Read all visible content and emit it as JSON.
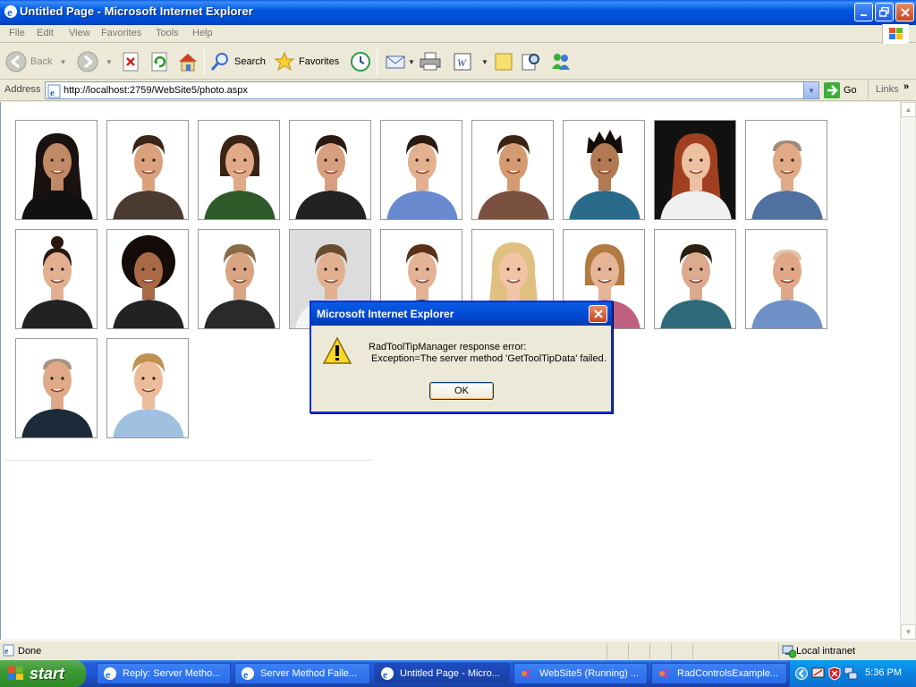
{
  "window": {
    "title": "Untitled Page - Microsoft Internet Explorer"
  },
  "menu": [
    "File",
    "Edit",
    "View",
    "Favorites",
    "Tools",
    "Help"
  ],
  "toolbar": {
    "back_label": "Back",
    "search_label": "Search",
    "favorites_label": "Favorites"
  },
  "address": {
    "label": "Address",
    "url": "http://localhost:2759/WebSite5/photo.aspx",
    "go_label": "Go",
    "links_label": "Links"
  },
  "photos": [
    {
      "bg": "#ffffff",
      "skin": "#c08a66",
      "hair": "#1a1210",
      "shirt": "#111111",
      "style": "long"
    },
    {
      "bg": "#ffffff",
      "skin": "#d9a27c",
      "hair": "#3a2518",
      "shirt": "#4a3a30",
      "style": "short"
    },
    {
      "bg": "#ffffff",
      "skin": "#e0aa88",
      "hair": "#3a2416",
      "shirt": "#2e5a2a",
      "style": "bob"
    },
    {
      "bg": "#ffffff",
      "skin": "#d6a080",
      "hair": "#2a1a12",
      "shirt": "#222222",
      "style": "short"
    },
    {
      "bg": "#ffffff",
      "skin": "#e3b090",
      "hair": "#2a1a10",
      "shirt": "#6a8ad0",
      "style": "short"
    },
    {
      "bg": "#ffffff",
      "skin": "#d49a72",
      "hair": "#3a2414",
      "shirt": "#7a5040",
      "style": "short"
    },
    {
      "bg": "#ffffff",
      "skin": "#b27a52",
      "hair": "#140c08",
      "shirt": "#2a6a8a",
      "style": "spiky"
    },
    {
      "bg": "#111111",
      "skin": "#ecc0a0",
      "hair": "#a04020",
      "shirt": "#f0f0f0",
      "style": "long"
    },
    {
      "bg": "#ffffff",
      "skin": "#e0aa86",
      "hair": "#5a3a20",
      "shirt": "#5070a0",
      "style": "bald"
    },
    {
      "bg": "#ffffff",
      "skin": "#e2b090",
      "hair": "#2a1810",
      "shirt": "#222222",
      "style": "bun"
    },
    {
      "bg": "#ffffff",
      "skin": "#a86a46",
      "hair": "#140c08",
      "shirt": "#222222",
      "style": "afro"
    },
    {
      "bg": "#ffffff",
      "skin": "#d8a482",
      "hair": "#8a6a48",
      "shirt": "#2a2a2a",
      "style": "short"
    },
    {
      "bg": "#dcdcdc",
      "skin": "#e0b090",
      "hair": "#6a4a30",
      "shirt": "#f4f4f4",
      "style": "short"
    },
    {
      "bg": "#ffffff",
      "skin": "#e4b294",
      "hair": "#5a3018",
      "shirt": "#222222",
      "style": "short"
    },
    {
      "bg": "#ffffff",
      "skin": "#f0c4a4",
      "hair": "#e0c080",
      "shirt": "#e8e8e8",
      "style": "long"
    },
    {
      "bg": "#ffffff",
      "skin": "#e6b496",
      "hair": "#b07a40",
      "shirt": "#c06080",
      "style": "bob"
    },
    {
      "bg": "#ffffff",
      "skin": "#dcaa8c",
      "hair": "#2a2010",
      "shirt": "#2e6a7a",
      "style": "short"
    },
    {
      "bg": "#ffffff",
      "skin": "#e0a888",
      "hair": "#c8a070",
      "shirt": "#7090c8",
      "style": "bald"
    },
    {
      "bg": "#ffffff",
      "skin": "#e0aa8a",
      "hair": "#6a4a2a",
      "shirt": "#1e2a3a",
      "style": "bald"
    },
    {
      "bg": "#ffffff",
      "skin": "#ecbc9a",
      "hair": "#c09050",
      "shirt": "#a0c0e0",
      "style": "short"
    }
  ],
  "dialog": {
    "title": "Microsoft Internet Explorer",
    "message": "RadToolTipManager response error:\n Exception=The server method 'GetToolTipData' failed.",
    "ok_label": "OK"
  },
  "status": {
    "text": "Done",
    "zone": "Local intranet"
  },
  "taskbar": {
    "start_label": "start",
    "tasks": [
      {
        "label": "Reply: Server Metho..."
      },
      {
        "label": "Server Method Faile..."
      },
      {
        "label": "Untitled Page - Micro..."
      },
      {
        "label": "WebSite5 (Running) ..."
      },
      {
        "label": "RadControlsExample..."
      }
    ],
    "clock": "5:36 PM"
  }
}
